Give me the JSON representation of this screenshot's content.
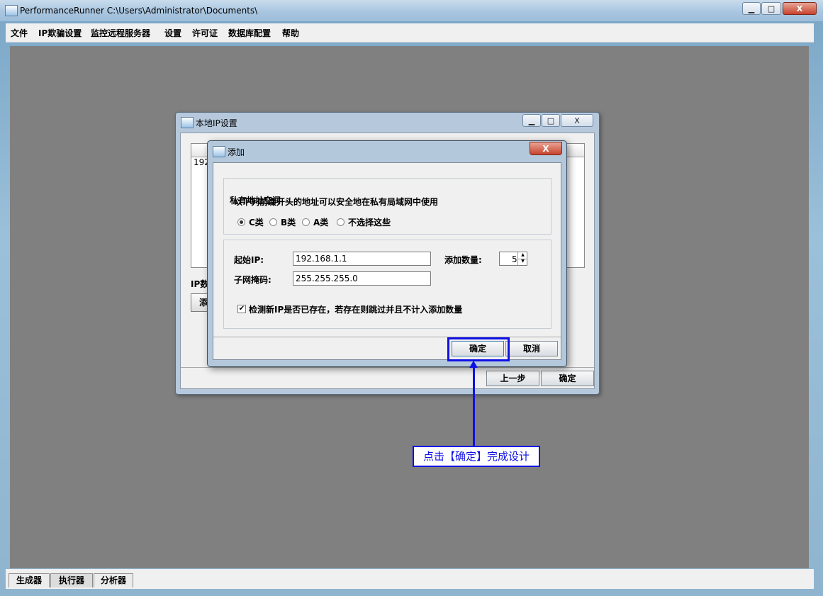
{
  "window": {
    "title": "PerformanceRunner  C:\\Users\\Administrator\\Documents\\",
    "minimize": "▁",
    "maximize": "□",
    "close": "X"
  },
  "menu": [
    "文件",
    "IP欺骗设置",
    "监控远程服务器",
    "设置",
    "许可证",
    "数据库配置",
    "帮助"
  ],
  "bottom_tabs": [
    {
      "label": "生成器",
      "active": false
    },
    {
      "label": "执行器",
      "active": true
    },
    {
      "label": "分析器",
      "active": false
    }
  ],
  "ip_window": {
    "title": "本地IP设置",
    "row_text": "192",
    "ip_count_label": "IP数",
    "add_button": "添",
    "prev_button": "上一步",
    "ok_button": "确定"
  },
  "add_dialog": {
    "title": "添加",
    "close": "X",
    "group_title": "私有地址空间",
    "description": "以下列前缀开头的地址可以安全地在私有局域网中使用",
    "radios": [
      {
        "label": "C类",
        "selected": true
      },
      {
        "label": "B类",
        "selected": false
      },
      {
        "label": "A类",
        "selected": false
      },
      {
        "label": "不选择这些",
        "selected": false
      }
    ],
    "start_ip_label": "起始IP:",
    "start_ip_value": "192.168.1.1",
    "count_label": "添加数量:",
    "count_value": "5",
    "subnet_label": "子网掩码:",
    "subnet_value": "255.255.255.0",
    "check_label": "检测新IP是否已存在，若存在则跳过并且不计入添加数量",
    "check_checked": true,
    "ok_button": "确定",
    "cancel_button": "取消"
  },
  "annotation": {
    "text": "点击【确定】完成设计",
    "color": "#1010e6"
  }
}
